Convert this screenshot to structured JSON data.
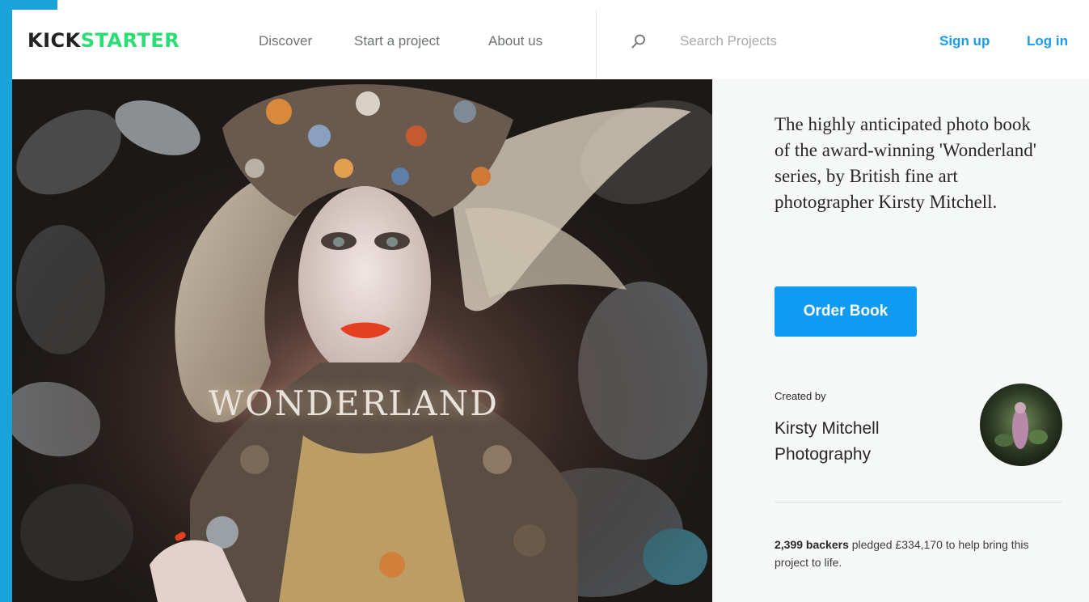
{
  "header": {
    "logo_kick": "KICK",
    "logo_starter": "STARTER",
    "nav": {
      "discover": "Discover",
      "start_project": "Start a project",
      "about": "About us"
    },
    "search": {
      "placeholder": "Search Projects",
      "icon": "search-icon"
    },
    "sign_up": "Sign up",
    "log_in": "Log in"
  },
  "hero": {
    "title": "WONDERLAND"
  },
  "project": {
    "blurb": "The highly anticipated photo book of the award-winning 'Wonderland' series, by British fine art photographer Kirsty Mitchell.",
    "cta_label": "Order Book",
    "created_by_label": "Created by",
    "creator_line1": "Kirsty Mitchell",
    "creator_line2": "Photography",
    "backers_count": "2,399 backers",
    "pledge_text": " pledged £334,170 to help bring this project to life."
  },
  "colors": {
    "brand_green": "#2bde73",
    "accent_blue": "#199cf0",
    "button_blue": "#0f9bf2",
    "frame_blue": "#1aa3d9"
  }
}
